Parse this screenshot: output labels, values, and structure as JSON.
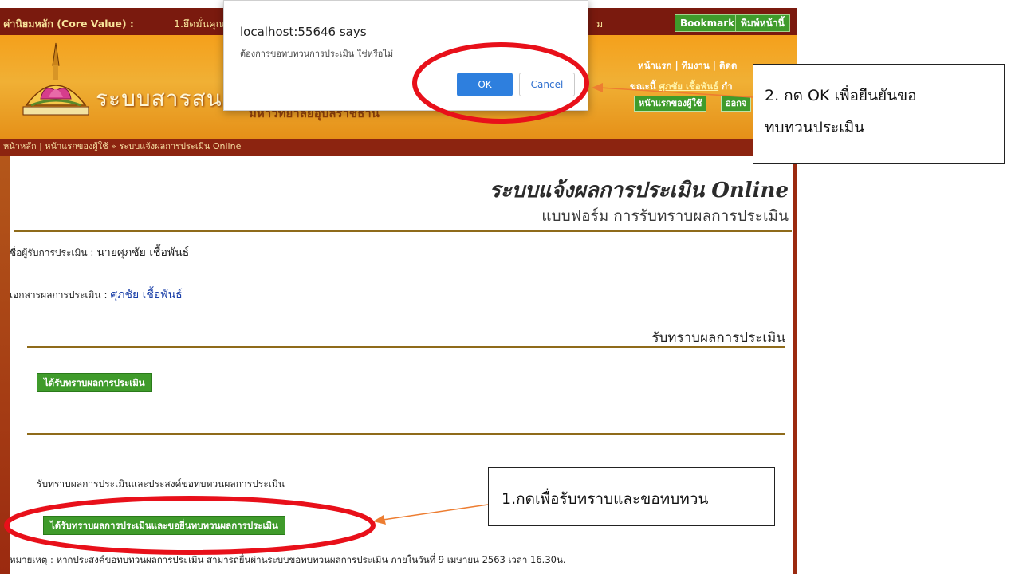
{
  "topbar": {
    "core_value_label": "ค่านิยมหลัก (Core Value) :",
    "core_value_1": "1.ยึดมั่นคุณ",
    "tail_text": "ม",
    "bookmark": "Bookmark",
    "print": "พิมพ์หน้านี้"
  },
  "header": {
    "site_title": "ระบบสารสนเ",
    "site_subtitle": "มหาวิทยาลัยอุบลราชธานี",
    "links": "หน้าแรก | ทีมงาน | ติดต",
    "user_line_prefix": "ขณะนี้",
    "user_name": "ศุภชัย เชื้อพันธ์",
    "user_line_suffix": "กำ",
    "home_user_btn": "หน้าแรกของผู้ใช้",
    "logout_btn": "ออกจ"
  },
  "breadcrumb": "หน้าหลัก | หน้าแรกของผู้ใช้ » ระบบแจ้งผลการประเมิน Online",
  "main": {
    "title": "ระบบแจ้งผลการประเมิน Online",
    "subtitle": "แบบฟอร์ม การรับทราบผลการประเมิน",
    "evaluatee_label": "ชื่อผู้รับการประเมิน :",
    "evaluatee_name": "นายศุภชัย เชื้อพันธ์",
    "document_label": "เอกสารผลการประเมิน :",
    "document_link": "ศุภชัย เชื้อพันธ์",
    "section_title": "รับทราบผลการประเมิน",
    "ack_button": "ได้รับทราบผลการประเมิน",
    "review_label": "รับทราบผลการประเมินและประสงค์ขอทบทวนผลการประเมิน",
    "review_button": "ได้รับทราบผลการประเมินและขอยื่นทบทวนผลการประเมิน",
    "note": "หมายเหตุ : หากประสงค์ขอทบทวนผลการประเมิน สามารถยื่นผ่านระบบขอทบทวนผลการประเมิน ภายในวันที่ 9 เมษายน 2563 เวลา 16.30น."
  },
  "dialog": {
    "title": "localhost:55646 says",
    "message": "ต้องการขอทบทวนการประเมิน ใช่หรือไม่",
    "ok": "OK",
    "cancel": "Cancel"
  },
  "annotations": {
    "callout_1": "1.กดเพื่อรับทราบและขอทบทวน",
    "callout_2_line1": "2. กด OK เพื่อยืนยันขอ",
    "callout_2_line2": "ทบทวนประเมิน",
    "ellipse_color": "#e8101a",
    "arrow_color": "#ed7d31"
  }
}
